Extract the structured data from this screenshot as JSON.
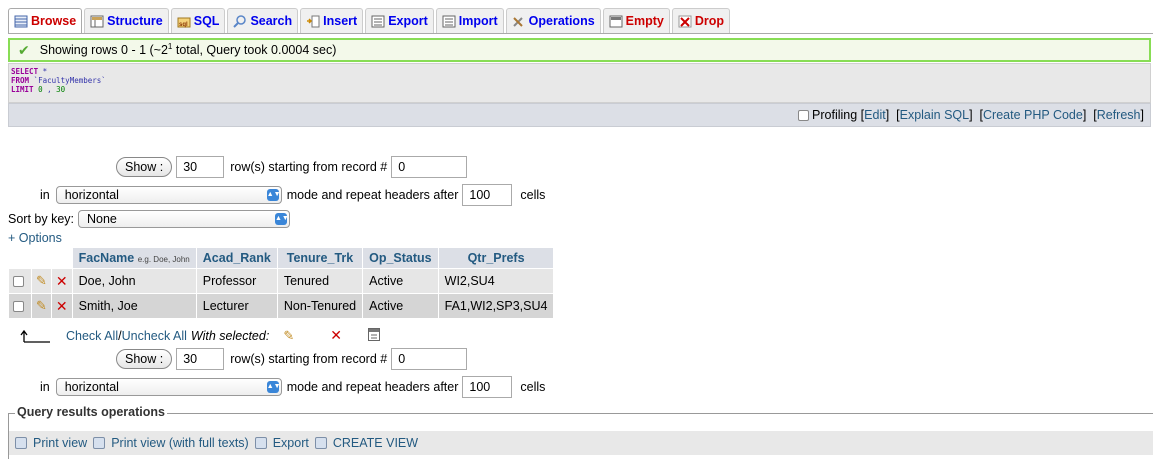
{
  "tabs": [
    {
      "label": "Browse",
      "icon": "browse-icon",
      "active": true
    },
    {
      "label": "Structure",
      "icon": "structure-icon"
    },
    {
      "label": "SQL",
      "icon": "sql-icon"
    },
    {
      "label": "Search",
      "icon": "search-icon"
    },
    {
      "label": "Insert",
      "icon": "insert-icon"
    },
    {
      "label": "Export",
      "icon": "export-icon"
    },
    {
      "label": "Import",
      "icon": "import-icon"
    },
    {
      "label": "Operations",
      "icon": "operations-icon"
    },
    {
      "label": "Empty",
      "icon": "empty-icon"
    },
    {
      "label": "Drop",
      "icon": "drop-icon"
    }
  ],
  "success": {
    "prefix": "Showing rows 0 - 1 (~2",
    "sup": "1",
    "suffix": " total, Query took 0.0004 sec)"
  },
  "sql": {
    "select_kw": "SELECT",
    "select_rest": " *",
    "from_kw": "FROM",
    "table": " `FacultyMembers`",
    "limit_kw": "LIMIT",
    "limit_a": " 0",
    "limit_sep": " , ",
    "limit_b": "30"
  },
  "sqlbar": {
    "profiling": "Profiling",
    "edit": "Edit",
    "explain": "Explain SQL",
    "php": "Create PHP Code",
    "refresh": "Refresh"
  },
  "nav": {
    "show_button": "Show :",
    "rows_value": "30",
    "starting_text": "row(s) starting from record #",
    "record_value": "0",
    "in_text": "in",
    "mode_value": "horizontal",
    "mode_text": "mode and repeat headers after",
    "headers_value": "100",
    "cells_text": "cells"
  },
  "sort": {
    "label": "Sort by key:",
    "value": "None"
  },
  "options_link": "+ Options",
  "table": {
    "columns": [
      {
        "label": "FacName",
        "hint": "e.g. Doe, John"
      },
      {
        "label": "Acad_Rank"
      },
      {
        "label": "Tenure_Trk"
      },
      {
        "label": "Op_Status"
      },
      {
        "label": "Qtr_Prefs"
      }
    ],
    "rows": [
      [
        "Doe, John",
        "Professor",
        "Tenured",
        "Active",
        "WI2,SU4"
      ],
      [
        "Smith, Joe",
        "Lecturer",
        "Non-Tenured",
        "Active",
        "FA1,WI2,SP3,SU4"
      ]
    ]
  },
  "bulk": {
    "check_all": "Check All",
    "separator": " / ",
    "uncheck_all": "Uncheck All",
    "with_selected": "With selected:"
  },
  "qro": {
    "legend": "Query results operations",
    "print_view": "Print view",
    "print_full": "Print view (with full texts)",
    "export": "Export",
    "create_view": "CREATE VIEW"
  },
  "colors": {
    "link": "#235a81",
    "success_border": "#88dd55",
    "header_bg": "#dcdfe6",
    "danger": "#cc0000"
  }
}
